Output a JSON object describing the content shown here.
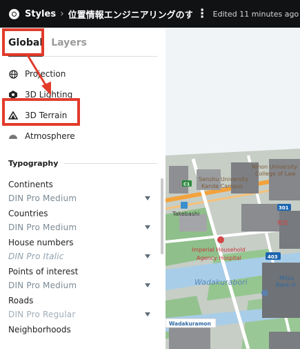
{
  "topbar": {
    "breadcrumb": "Styles",
    "title": "位置情報エンジニアリングのす...",
    "edited": "Edited 11 minutes ago"
  },
  "sidebar": {
    "tabs": [
      {
        "label": "Global",
        "active": true
      },
      {
        "label": "Layers",
        "active": false
      }
    ],
    "items": [
      {
        "label": "Projection",
        "icon": "globe-icon"
      },
      {
        "label": "3D Lighting",
        "icon": "lighting-icon"
      },
      {
        "label": "3D Terrain",
        "icon": "mountain-icon"
      },
      {
        "label": "Atmosphere",
        "icon": "atmosphere-icon"
      }
    ],
    "typography": {
      "heading": "Typography",
      "properties": [
        {
          "label": "Continents",
          "value": "DIN Pro Medium"
        },
        {
          "label": "Countries",
          "value": "DIN Pro Medium"
        },
        {
          "label": "House numbers",
          "value": "DIN Pro Italic"
        },
        {
          "label": "Points of interest",
          "value": "DIN Pro Medium"
        },
        {
          "label": "Roads",
          "value": "DIN Pro Regular"
        },
        {
          "label": "Neighborhoods",
          "value": ""
        }
      ]
    }
  },
  "map": {
    "labels": {
      "nihon_university": "Nihon University",
      "college_of_law": "College of Law",
      "senshu_university": "Senshu University",
      "kanda_campus": "Kanda Campus",
      "takebashi": "Takebashi",
      "imperial_household": "Imperial Household",
      "agency_hospital": "Agency Hospital",
      "wadakurabori": "Wadakurabori",
      "mitsu": "Mitsu",
      "bank_h": "Bank H",
      "wadakuramon": "Wadakuramon",
      "shield_301": "301",
      "shield_403": "403",
      "route_c1": "C1",
      "kanji_fragment": "和気"
    }
  },
  "colors": {
    "accent": "#e23b2a",
    "topbar": "#111214",
    "road": "#f3a23c",
    "water": "#aacde8",
    "shield": "#1d65b0"
  }
}
